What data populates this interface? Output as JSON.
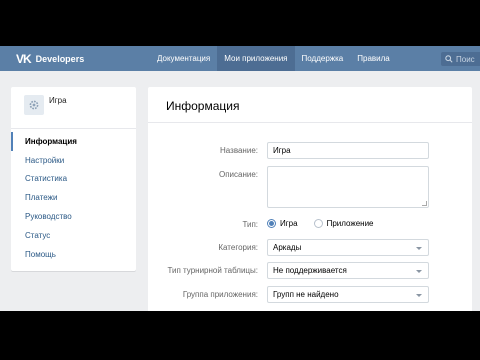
{
  "navbar": {
    "logo_text": "VK",
    "brand": "Developers",
    "tabs": [
      {
        "label": "Документация",
        "active": false
      },
      {
        "label": "Мои приложения",
        "active": true
      },
      {
        "label": "Поддержка",
        "active": false
      },
      {
        "label": "Правила",
        "active": false
      }
    ],
    "search": {
      "text": "Поис",
      "icon": "search-icon"
    },
    "color": "#5b7fa6"
  },
  "sidebar": {
    "app_name": "Игра",
    "app_icon": "gear-icon",
    "items": [
      {
        "label": "Информация",
        "active": true
      },
      {
        "label": "Настройки",
        "active": false
      },
      {
        "label": "Статистика",
        "active": false
      },
      {
        "label": "Платежи",
        "active": false
      },
      {
        "label": "Руководство",
        "active": false
      },
      {
        "label": "Статус",
        "active": false
      },
      {
        "label": "Помощь",
        "active": false
      }
    ]
  },
  "main": {
    "title": "Информация",
    "form": {
      "name_label": "Название:",
      "name_value": "Игра",
      "description_label": "Описание:",
      "description_value": "",
      "type_label": "Тип:",
      "type_options": [
        {
          "label": "Игра",
          "checked": true
        },
        {
          "label": "Приложение",
          "checked": false
        }
      ],
      "category_label": "Категория:",
      "category_value": "Аркады",
      "tournament_label": "Тип турнирной таблицы:",
      "tournament_value": "Не поддерживается",
      "group_label": "Группа приложения:",
      "group_value": "Групп не найдено"
    }
  },
  "colors": {
    "accent": "#5181b8",
    "link": "#2a5885",
    "background": "#edeef0"
  }
}
